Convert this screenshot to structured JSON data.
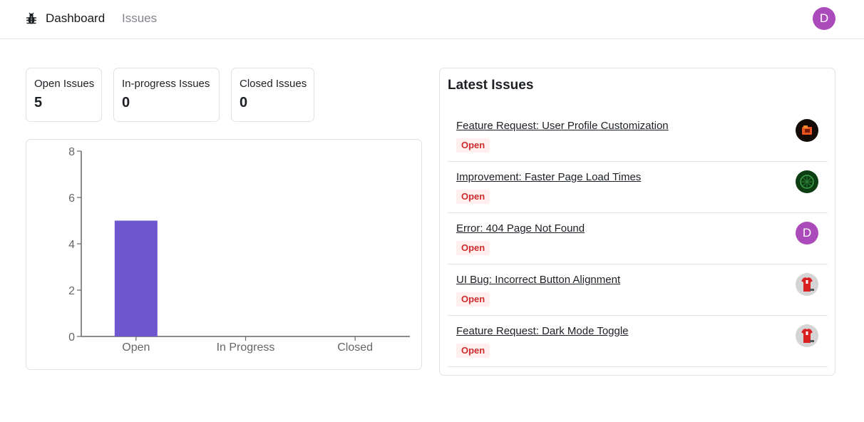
{
  "nav": {
    "dashboard_label": "Dashboard",
    "issues_label": "Issues",
    "avatar_initial": "D",
    "avatar_color": "#ab4aba",
    "logo_icon": "bug-icon"
  },
  "summary": [
    {
      "label": "Open Issues",
      "value": "5"
    },
    {
      "label": "In-progress Issues",
      "value": "0"
    },
    {
      "label": "Closed Issues",
      "value": "0"
    }
  ],
  "chart_data": {
    "type": "bar",
    "categories": [
      "Open",
      "In Progress",
      "Closed"
    ],
    "values": [
      5,
      0,
      0
    ],
    "ylim": [
      0,
      8
    ],
    "yticks": [
      0,
      2,
      4,
      6,
      8
    ],
    "bar_color": "#6e56cf",
    "grid": false,
    "title": "",
    "xlabel": "",
    "ylabel": ""
  },
  "latest": {
    "title": "Latest Issues",
    "badge_color": "#ce2c31",
    "issues": [
      {
        "title": "Feature Request: User Profile Customization",
        "status": "Open",
        "avatar": "dark-logo-avatar"
      },
      {
        "title": "Improvement: Faster Page Load Times",
        "status": "Open",
        "avatar": "green-pattern-avatar"
      },
      {
        "title": "Error: 404 Page Not Found",
        "status": "Open",
        "avatar": "D"
      },
      {
        "title": "UI Bug: Incorrect Button Alignment",
        "status": "Open",
        "avatar": "red-shirt-avatar"
      },
      {
        "title": "Feature Request: Dark Mode Toggle",
        "status": "Open",
        "avatar": "red-shirt-avatar"
      }
    ]
  }
}
